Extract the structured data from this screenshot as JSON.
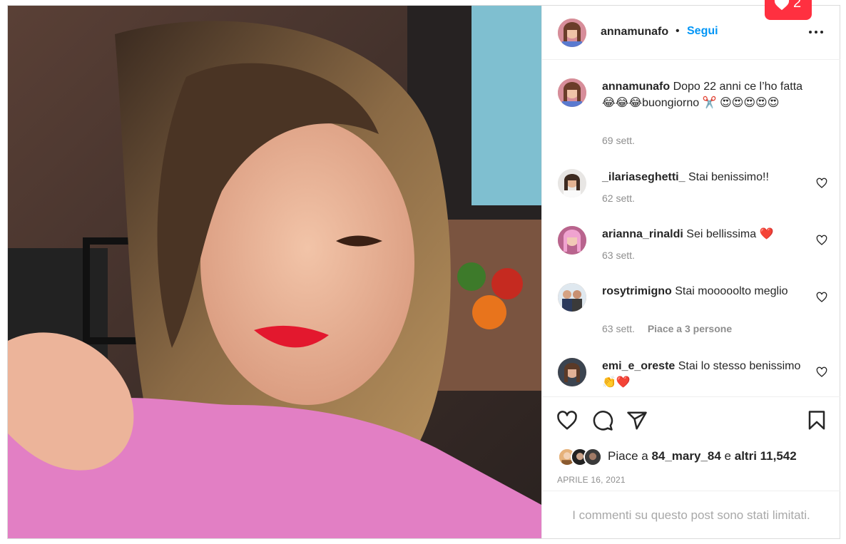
{
  "post": {
    "author": "annamunafo",
    "follow_label": "Segui",
    "separator": "•",
    "caption": {
      "user": "annamunafo",
      "text": "Dopo 22 anni ce l’ho fatta 😂😂😂buongiorno ✂️ 😍😍😍😍😍",
      "time": "69 sett."
    },
    "comments": [
      {
        "user": "_ilariaseghetti_",
        "text": "Stai benissimo!!",
        "time": "62 sett.",
        "likes": ""
      },
      {
        "user": "arianna_rinaldi",
        "text": "Sei bellissima ❤️",
        "time": "63 sett.",
        "likes": ""
      },
      {
        "user": "rosytrimigno",
        "text": "Stai mooooolto meglio",
        "time": "63 sett.",
        "likes": "Piace a 3 persone"
      },
      {
        "user": "emi_e_oreste",
        "text": "Stai lo stesso benissimo 👏❤️",
        "time": "",
        "likes": ""
      }
    ],
    "likes": {
      "prefix": "Piace a",
      "user": "84_mary_84",
      "conj": "e",
      "others": "altri 11,542"
    },
    "date": "APRILE 16, 2021",
    "limited_notice": "I commenti su questo post sono stati limitati."
  },
  "notification": {
    "count": "2",
    "color": "#ff3040"
  },
  "icons": [
    "more-icon",
    "heart-icon",
    "comment-icon",
    "share-icon",
    "bookmark-icon"
  ],
  "colors": {
    "accent": "#0095f6",
    "muted": "#8e8e8e",
    "text": "#262626",
    "like_red": "#ff3040"
  }
}
